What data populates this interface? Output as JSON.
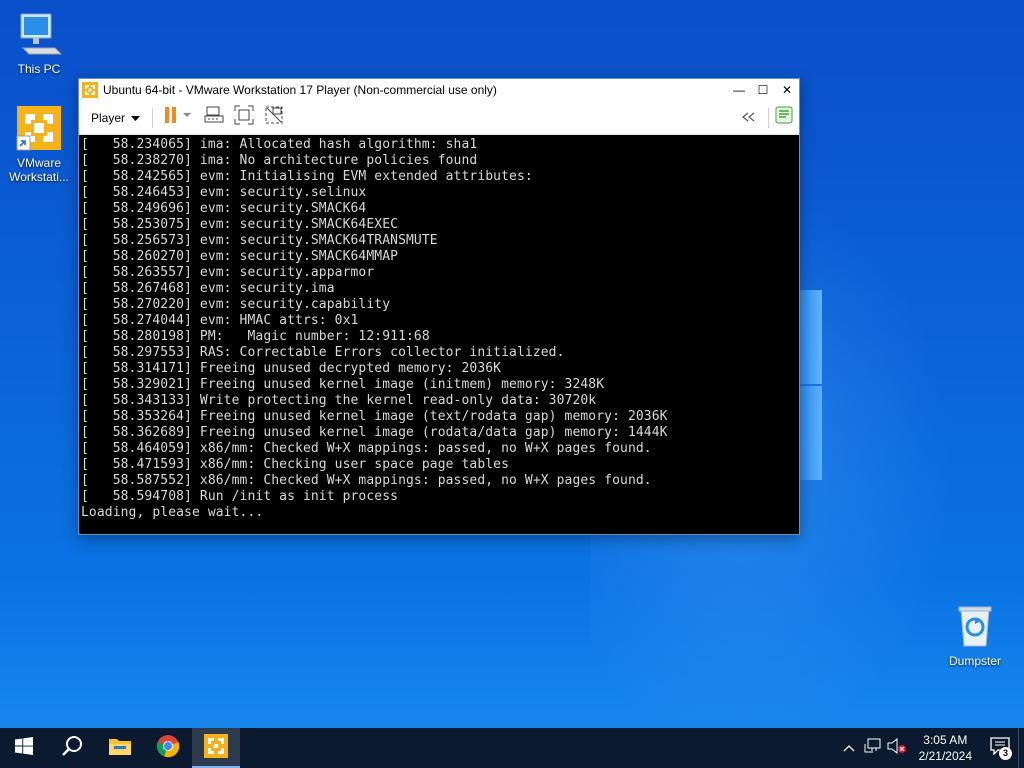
{
  "desktop": {
    "icons": [
      {
        "label": "This PC"
      },
      {
        "label": "VMware Workstati..."
      },
      {
        "label": "Dumpster"
      }
    ]
  },
  "window": {
    "title": "Ubuntu 64-bit - VMware Workstation 17 Player (Non-commercial use only)",
    "controls": {
      "minimize": "—",
      "maximize": "☐",
      "close": "✕"
    },
    "toolbar": {
      "player_label": "Player",
      "icons": [
        "pause-icon",
        "send-ctrl-alt-del-icon",
        "fit-guest-icon",
        "unity-icon",
        "back-icon",
        "message-log-icon"
      ]
    },
    "console_lines": [
      "[   58.234065] ima: Allocated hash algorithm: sha1",
      "[   58.238270] ima: No architecture policies found",
      "[   58.242565] evm: Initialising EVM extended attributes:",
      "[   58.246453] evm: security.selinux",
      "[   58.249696] evm: security.SMACK64",
      "[   58.253075] evm: security.SMACK64EXEC",
      "[   58.256573] evm: security.SMACK64TRANSMUTE",
      "[   58.260270] evm: security.SMACK64MMAP",
      "[   58.263557] evm: security.apparmor",
      "[   58.267468] evm: security.ima",
      "[   58.270220] evm: security.capability",
      "[   58.274044] evm: HMAC attrs: 0x1",
      "[   58.280198] PM:   Magic number: 12:911:68",
      "[   58.297553] RAS: Correctable Errors collector initialized.",
      "[   58.314171] Freeing unused decrypted memory: 2036K",
      "[   58.329021] Freeing unused kernel image (initmem) memory: 3248K",
      "[   58.343133] Write protecting the kernel read-only data: 30720k",
      "[   58.353264] Freeing unused kernel image (text/rodata gap) memory: 2036K",
      "[   58.362689] Freeing unused kernel image (rodata/data gap) memory: 1444K",
      "[   58.464059] x86/mm: Checked W+X mappings: passed, no W+X pages found.",
      "[   58.471593] x86/mm: Checking user space page tables",
      "[   58.587552] x86/mm: Checked W+X mappings: passed, no W+X pages found.",
      "[   58.594708] Run /init as init process",
      "Loading, please wait..."
    ]
  },
  "taskbar": {
    "buttons": [
      "start-icon",
      "search-icon",
      "file-explorer-icon",
      "chrome-icon",
      "vmware-icon"
    ],
    "tray_icons": [
      "chevron-up-icon",
      "network-icon",
      "volume-muted-icon"
    ],
    "clock_time": "3:05 AM",
    "clock_date": "2/21/2024",
    "notification_count": "3"
  },
  "colors": {
    "desktop": "#0b63d8",
    "taskbar": "#0b1a2e",
    "console_bg": "#000000",
    "console_text": "#d8d8d8",
    "pause_orange": "#f08a24"
  }
}
